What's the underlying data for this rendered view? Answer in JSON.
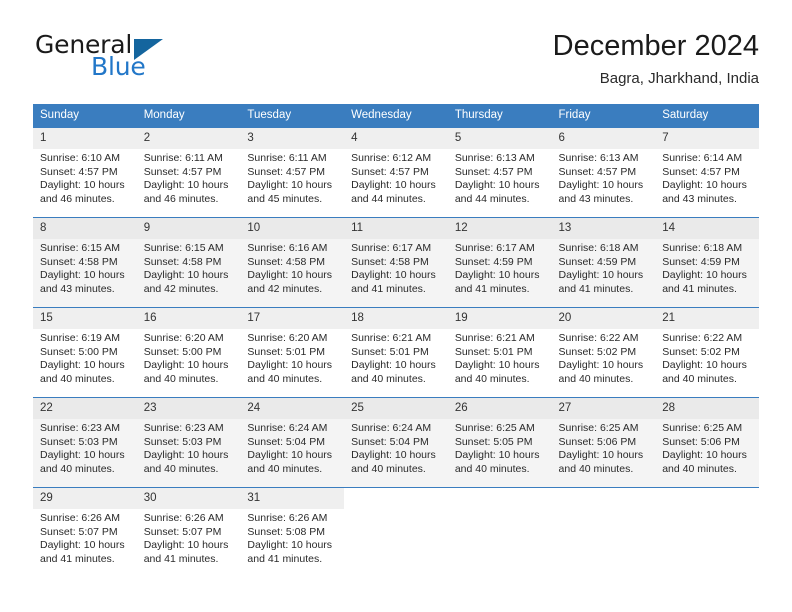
{
  "brand": {
    "name_part1": "General",
    "name_part2": "Blue",
    "triangle_color": "#14659e",
    "blue_color": "#2277c8"
  },
  "header": {
    "title": "December 2024",
    "location": "Bagra, Jharkhand, India"
  },
  "theme": {
    "header_bg": "#3a7dbf",
    "header_text": "#ffffff",
    "alt_row_bg": "#f4f4f4",
    "daynum_bg": "#efefef"
  },
  "weekday_headers": [
    "Sunday",
    "Monday",
    "Tuesday",
    "Wednesday",
    "Thursday",
    "Friday",
    "Saturday"
  ],
  "labels": {
    "sunrise_prefix": "Sunrise:",
    "sunset_prefix": "Sunset:",
    "daylight_prefix": "Daylight:"
  },
  "weeks": [
    {
      "alt": false,
      "days": [
        {
          "num": "1",
          "sunrise": "Sunrise: 6:10 AM",
          "sunset": "Sunset: 4:57 PM",
          "daylight1": "Daylight: 10 hours",
          "daylight2": "and 46 minutes."
        },
        {
          "num": "2",
          "sunrise": "Sunrise: 6:11 AM",
          "sunset": "Sunset: 4:57 PM",
          "daylight1": "Daylight: 10 hours",
          "daylight2": "and 46 minutes."
        },
        {
          "num": "3",
          "sunrise": "Sunrise: 6:11 AM",
          "sunset": "Sunset: 4:57 PM",
          "daylight1": "Daylight: 10 hours",
          "daylight2": "and 45 minutes."
        },
        {
          "num": "4",
          "sunrise": "Sunrise: 6:12 AM",
          "sunset": "Sunset: 4:57 PM",
          "daylight1": "Daylight: 10 hours",
          "daylight2": "and 44 minutes."
        },
        {
          "num": "5",
          "sunrise": "Sunrise: 6:13 AM",
          "sunset": "Sunset: 4:57 PM",
          "daylight1": "Daylight: 10 hours",
          "daylight2": "and 44 minutes."
        },
        {
          "num": "6",
          "sunrise": "Sunrise: 6:13 AM",
          "sunset": "Sunset: 4:57 PM",
          "daylight1": "Daylight: 10 hours",
          "daylight2": "and 43 minutes."
        },
        {
          "num": "7",
          "sunrise": "Sunrise: 6:14 AM",
          "sunset": "Sunset: 4:57 PM",
          "daylight1": "Daylight: 10 hours",
          "daylight2": "and 43 minutes."
        }
      ]
    },
    {
      "alt": true,
      "days": [
        {
          "num": "8",
          "sunrise": "Sunrise: 6:15 AM",
          "sunset": "Sunset: 4:58 PM",
          "daylight1": "Daylight: 10 hours",
          "daylight2": "and 43 minutes."
        },
        {
          "num": "9",
          "sunrise": "Sunrise: 6:15 AM",
          "sunset": "Sunset: 4:58 PM",
          "daylight1": "Daylight: 10 hours",
          "daylight2": "and 42 minutes."
        },
        {
          "num": "10",
          "sunrise": "Sunrise: 6:16 AM",
          "sunset": "Sunset: 4:58 PM",
          "daylight1": "Daylight: 10 hours",
          "daylight2": "and 42 minutes."
        },
        {
          "num": "11",
          "sunrise": "Sunrise: 6:17 AM",
          "sunset": "Sunset: 4:58 PM",
          "daylight1": "Daylight: 10 hours",
          "daylight2": "and 41 minutes."
        },
        {
          "num": "12",
          "sunrise": "Sunrise: 6:17 AM",
          "sunset": "Sunset: 4:59 PM",
          "daylight1": "Daylight: 10 hours",
          "daylight2": "and 41 minutes."
        },
        {
          "num": "13",
          "sunrise": "Sunrise: 6:18 AM",
          "sunset": "Sunset: 4:59 PM",
          "daylight1": "Daylight: 10 hours",
          "daylight2": "and 41 minutes."
        },
        {
          "num": "14",
          "sunrise": "Sunrise: 6:18 AM",
          "sunset": "Sunset: 4:59 PM",
          "daylight1": "Daylight: 10 hours",
          "daylight2": "and 41 minutes."
        }
      ]
    },
    {
      "alt": false,
      "days": [
        {
          "num": "15",
          "sunrise": "Sunrise: 6:19 AM",
          "sunset": "Sunset: 5:00 PM",
          "daylight1": "Daylight: 10 hours",
          "daylight2": "and 40 minutes."
        },
        {
          "num": "16",
          "sunrise": "Sunrise: 6:20 AM",
          "sunset": "Sunset: 5:00 PM",
          "daylight1": "Daylight: 10 hours",
          "daylight2": "and 40 minutes."
        },
        {
          "num": "17",
          "sunrise": "Sunrise: 6:20 AM",
          "sunset": "Sunset: 5:01 PM",
          "daylight1": "Daylight: 10 hours",
          "daylight2": "and 40 minutes."
        },
        {
          "num": "18",
          "sunrise": "Sunrise: 6:21 AM",
          "sunset": "Sunset: 5:01 PM",
          "daylight1": "Daylight: 10 hours",
          "daylight2": "and 40 minutes."
        },
        {
          "num": "19",
          "sunrise": "Sunrise: 6:21 AM",
          "sunset": "Sunset: 5:01 PM",
          "daylight1": "Daylight: 10 hours",
          "daylight2": "and 40 minutes."
        },
        {
          "num": "20",
          "sunrise": "Sunrise: 6:22 AM",
          "sunset": "Sunset: 5:02 PM",
          "daylight1": "Daylight: 10 hours",
          "daylight2": "and 40 minutes."
        },
        {
          "num": "21",
          "sunrise": "Sunrise: 6:22 AM",
          "sunset": "Sunset: 5:02 PM",
          "daylight1": "Daylight: 10 hours",
          "daylight2": "and 40 minutes."
        }
      ]
    },
    {
      "alt": true,
      "days": [
        {
          "num": "22",
          "sunrise": "Sunrise: 6:23 AM",
          "sunset": "Sunset: 5:03 PM",
          "daylight1": "Daylight: 10 hours",
          "daylight2": "and 40 minutes."
        },
        {
          "num": "23",
          "sunrise": "Sunrise: 6:23 AM",
          "sunset": "Sunset: 5:03 PM",
          "daylight1": "Daylight: 10 hours",
          "daylight2": "and 40 minutes."
        },
        {
          "num": "24",
          "sunrise": "Sunrise: 6:24 AM",
          "sunset": "Sunset: 5:04 PM",
          "daylight1": "Daylight: 10 hours",
          "daylight2": "and 40 minutes."
        },
        {
          "num": "25",
          "sunrise": "Sunrise: 6:24 AM",
          "sunset": "Sunset: 5:04 PM",
          "daylight1": "Daylight: 10 hours",
          "daylight2": "and 40 minutes."
        },
        {
          "num": "26",
          "sunrise": "Sunrise: 6:25 AM",
          "sunset": "Sunset: 5:05 PM",
          "daylight1": "Daylight: 10 hours",
          "daylight2": "and 40 minutes."
        },
        {
          "num": "27",
          "sunrise": "Sunrise: 6:25 AM",
          "sunset": "Sunset: 5:06 PM",
          "daylight1": "Daylight: 10 hours",
          "daylight2": "and 40 minutes."
        },
        {
          "num": "28",
          "sunrise": "Sunrise: 6:25 AM",
          "sunset": "Sunset: 5:06 PM",
          "daylight1": "Daylight: 10 hours",
          "daylight2": "and 40 minutes."
        }
      ]
    },
    {
      "alt": false,
      "days": [
        {
          "num": "29",
          "sunrise": "Sunrise: 6:26 AM",
          "sunset": "Sunset: 5:07 PM",
          "daylight1": "Daylight: 10 hours",
          "daylight2": "and 41 minutes."
        },
        {
          "num": "30",
          "sunrise": "Sunrise: 6:26 AM",
          "sunset": "Sunset: 5:07 PM",
          "daylight1": "Daylight: 10 hours",
          "daylight2": "and 41 minutes."
        },
        {
          "num": "31",
          "sunrise": "Sunrise: 6:26 AM",
          "sunset": "Sunset: 5:08 PM",
          "daylight1": "Daylight: 10 hours",
          "daylight2": "and 41 minutes."
        },
        {
          "num": "",
          "sunrise": "",
          "sunset": "",
          "daylight1": "",
          "daylight2": ""
        },
        {
          "num": "",
          "sunrise": "",
          "sunset": "",
          "daylight1": "",
          "daylight2": ""
        },
        {
          "num": "",
          "sunrise": "",
          "sunset": "",
          "daylight1": "",
          "daylight2": ""
        },
        {
          "num": "",
          "sunrise": "",
          "sunset": "",
          "daylight1": "",
          "daylight2": ""
        }
      ]
    }
  ]
}
